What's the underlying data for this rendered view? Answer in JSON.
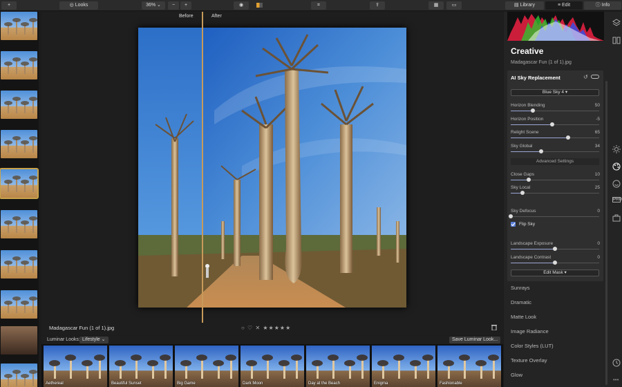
{
  "toolbar": {
    "add_label": "+",
    "looks_label": "Looks",
    "zoom_value": "36%",
    "zoom_minus": "−",
    "zoom_plus": "+",
    "tab_library": "Library",
    "tab_edit": "Edit",
    "tab_info": "Info"
  },
  "viewer": {
    "before_label": "Before",
    "after_label": "After",
    "filename": "Madagascar Fun (1 of 1).jpg",
    "rating": "○ ♡  ✕ ★★★★★"
  },
  "looksbar": {
    "label": "Luminar Looks:",
    "category": "Lifestyle",
    "save_button": "Save Luminar Look..."
  },
  "looks": [
    {
      "name": "Aethereal"
    },
    {
      "name": "Beautiful Sunset"
    },
    {
      "name": "Big Game"
    },
    {
      "name": "Dark Moon"
    },
    {
      "name": "Day at the Beach"
    },
    {
      "name": "Enigma"
    },
    {
      "name": "Fashionable"
    }
  ],
  "panel": {
    "title": "Creative",
    "filename": "Madagascar Fun (1 of 1).jpg"
  },
  "ai_sky": {
    "title": "AI Sky Replacement",
    "sky_preset": "Blue Sky 4",
    "advanced_settings": "Advanced Settings",
    "flip_sky": "Flip Sky",
    "edit_mask": "Edit Mask",
    "sliders": [
      {
        "label": "Horizon Blending",
        "value": "50",
        "fraction": 0.25
      },
      {
        "label": "Horizon Position",
        "value": "-5",
        "fraction": 0.47
      },
      {
        "label": "Relight Scene",
        "value": "65",
        "fraction": 0.65
      },
      {
        "label": "Sky Global",
        "value": "34",
        "fraction": 0.34
      },
      {
        "label": "Close Gaps",
        "value": "10",
        "fraction": 0.2
      },
      {
        "label": "Sky Local",
        "value": "25",
        "fraction": 0.13
      },
      {
        "label": "Sky Defocus",
        "value": "0",
        "fraction": 0.0
      },
      {
        "label": "Landscape Exposure",
        "value": "0",
        "fraction": 0.5
      },
      {
        "label": "Landscape Contrast",
        "value": "0",
        "fraction": 0.5
      }
    ]
  },
  "tools": [
    "Sunrays",
    "Dramatic",
    "Matte Look",
    "Image Radiance",
    "Color Styles (LUT)",
    "Texture Overlay",
    "Glow"
  ],
  "side_icons": [
    "layers-icon",
    "canvas-icon",
    "sun-icon",
    "palette-icon",
    "face-icon",
    "pro-icon",
    "briefcase-icon",
    "history-icon"
  ],
  "colors": {
    "accent": "#c8a24a",
    "slider": "#9aa7d6",
    "checkbox": "#5a7fd8"
  }
}
